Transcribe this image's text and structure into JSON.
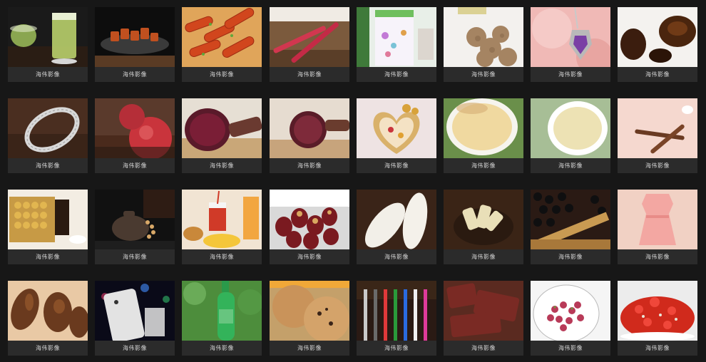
{
  "gallery": {
    "items": [
      {
        "caption": "海伟影像",
        "subject": "green-tea"
      },
      {
        "caption": "海伟影像",
        "subject": "braised-meat"
      },
      {
        "caption": "海伟影像",
        "subject": "spicy-rice-cakes"
      },
      {
        "caption": "海伟影像",
        "subject": "red-pens"
      },
      {
        "caption": "海伟影像",
        "subject": "flower-gift-box"
      },
      {
        "caption": "海伟影像",
        "subject": "walnuts"
      },
      {
        "caption": "海伟影像",
        "subject": "amethyst-pendant"
      },
      {
        "caption": "海伟影像",
        "subject": "black-fungus"
      },
      {
        "caption": "海伟影像",
        "subject": "silver-bracelet"
      },
      {
        "caption": "海伟影像",
        "subject": "red-apple"
      },
      {
        "caption": "海伟影像",
        "subject": "purple-sweet-potato"
      },
      {
        "caption": "海伟影像",
        "subject": "sliced-sweet-potato"
      },
      {
        "caption": "海伟影像",
        "subject": "heart-candy-box"
      },
      {
        "caption": "海伟影像",
        "subject": "honey-bowl"
      },
      {
        "caption": "海伟影像",
        "subject": "tea-cup"
      },
      {
        "caption": "海伟影像",
        "subject": "dried-roots"
      },
      {
        "caption": "海伟影像",
        "subject": "chocolate-box"
      },
      {
        "caption": "海伟影像",
        "subject": "clay-teapot"
      },
      {
        "caption": "海伟影像",
        "subject": "fast-food"
      },
      {
        "caption": "海伟影像",
        "subject": "red-dates"
      },
      {
        "caption": "海伟影像",
        "subject": "cuttlefish-bone"
      },
      {
        "caption": "海伟影像",
        "subject": "dried-slices"
      },
      {
        "caption": "海伟影像",
        "subject": "black-beans"
      },
      {
        "caption": "海伟影像",
        "subject": "pink-dress"
      },
      {
        "caption": "海伟影像",
        "subject": "dried-fungus"
      },
      {
        "caption": "海伟影像",
        "subject": "smartphone"
      },
      {
        "caption": "海伟影像",
        "subject": "green-bottle"
      },
      {
        "caption": "海伟影像",
        "subject": "cookies"
      },
      {
        "caption": "海伟影像",
        "subject": "e-cigarettes"
      },
      {
        "caption": "海伟影像",
        "subject": "dried-beef"
      },
      {
        "caption": "海伟影像",
        "subject": "rose-tea"
      },
      {
        "caption": "海伟影像",
        "subject": "chopped-chili"
      }
    ]
  }
}
